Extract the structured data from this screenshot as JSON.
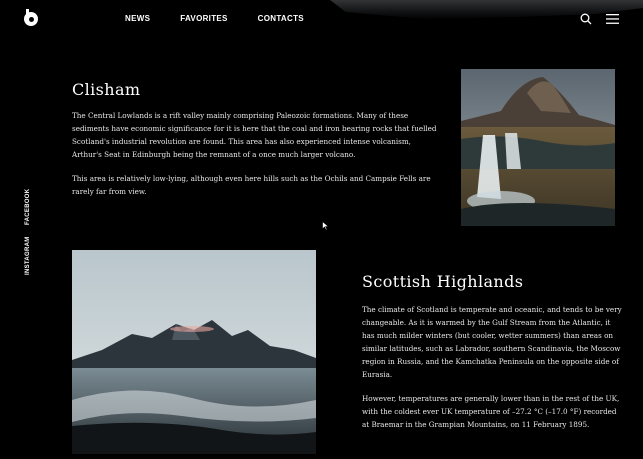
{
  "nav": {
    "items": [
      "NEWS",
      "FAVORITES",
      "CONTACTS"
    ]
  },
  "icons": {
    "logo": "logo-b-icon",
    "search": "search-icon",
    "menu": "hamburger-menu-icon"
  },
  "social": {
    "facebook": "FACEBOOK",
    "instagram": "INSTAGRAM"
  },
  "sections": [
    {
      "title": "Clisham",
      "paragraphs": [
        "The Central Lowlands is a rift valley mainly comprising Paleozoic formations. Many of these sediments have economic significance for it is here that the coal and iron bearing rocks that fuelled Scotland's industrial revolution are found. This area has also experienced intense volcanism, Arthur's Seat in Edinburgh being the remnant of a once much larger volcano.",
        "This area is relatively low-lying, although even here hills such as the Ochils and Campsie Fells are rarely far from view."
      ]
    },
    {
      "title": "Scottish Highlands",
      "paragraphs": [
        "The climate of Scotland is temperate and oceanic, and tends to be very changeable. As it is warmed by the Gulf Stream from the Atlantic, it has much milder winters (but cooler, wetter summers) than areas on similar latitudes, such as Labrador, southern Scandinavia, the Moscow region in Russia, and the Kamchatka Peninsula on the opposite side of Eurasia.",
        "However, temperatures are generally lower than in the rest of the UK, with the coldest ever UK temperature of –27.2 °C (–17.0 °F) recorded at Braemar in the Grampian Mountains, on 11 February 1895."
      ]
    }
  ],
  "colors": {
    "background": "#000000",
    "text": "#ffffff"
  }
}
